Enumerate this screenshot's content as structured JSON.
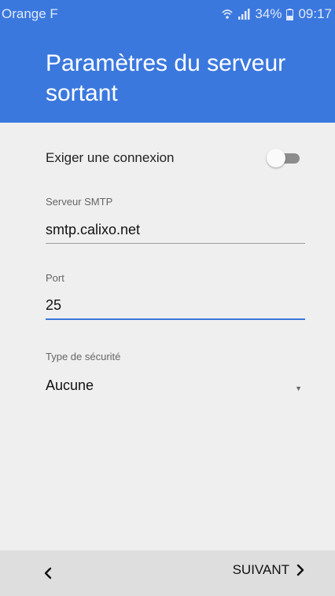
{
  "status_bar": {
    "carrier": "Orange F",
    "battery": "34%",
    "time": "09:17",
    "icons": [
      "wifi-icon",
      "signal-icon",
      "battery-icon"
    ]
  },
  "header": {
    "title": "Paramètres du serveur sortant"
  },
  "form": {
    "require_login": {
      "label": "Exiger une connexion",
      "enabled": false
    },
    "smtp_server": {
      "label": "Serveur SMTP",
      "value": "smtp.calixo.net"
    },
    "port": {
      "label": "Port",
      "value": "25"
    },
    "security_type": {
      "label": "Type de sécurité",
      "value": "Aucune"
    }
  },
  "footer": {
    "next_label": "SUIVANT"
  },
  "colors": {
    "accent": "#3b78de",
    "background": "#efefef",
    "footer": "#dedede"
  }
}
